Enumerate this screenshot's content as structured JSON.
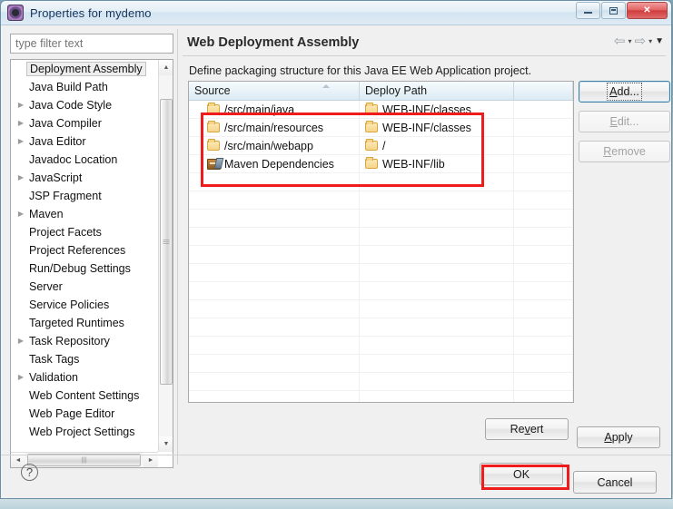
{
  "window": {
    "title": "Properties for mydemo",
    "icon": "eclipse-icon",
    "minimize_label": "",
    "maximize_label": "",
    "close_label": "✕"
  },
  "sidebar": {
    "filter": {
      "placeholder": "type filter text",
      "value": ""
    },
    "items": [
      {
        "label": "Deployment Assembly",
        "expandable": false,
        "selected": true
      },
      {
        "label": "Java Build Path",
        "expandable": false,
        "selected": false
      },
      {
        "label": "Java Code Style",
        "expandable": true,
        "selected": false
      },
      {
        "label": "Java Compiler",
        "expandable": true,
        "selected": false
      },
      {
        "label": "Java Editor",
        "expandable": true,
        "selected": false
      },
      {
        "label": "Javadoc Location",
        "expandable": false,
        "selected": false
      },
      {
        "label": "JavaScript",
        "expandable": true,
        "selected": false
      },
      {
        "label": "JSP Fragment",
        "expandable": false,
        "selected": false
      },
      {
        "label": "Maven",
        "expandable": true,
        "selected": false
      },
      {
        "label": "Project Facets",
        "expandable": false,
        "selected": false
      },
      {
        "label": "Project References",
        "expandable": false,
        "selected": false
      },
      {
        "label": "Run/Debug Settings",
        "expandable": false,
        "selected": false
      },
      {
        "label": "Server",
        "expandable": false,
        "selected": false
      },
      {
        "label": "Service Policies",
        "expandable": false,
        "selected": false
      },
      {
        "label": "Targeted Runtimes",
        "expandable": false,
        "selected": false
      },
      {
        "label": "Task Repository",
        "expandable": true,
        "selected": false
      },
      {
        "label": "Task Tags",
        "expandable": false,
        "selected": false
      },
      {
        "label": "Validation",
        "expandable": true,
        "selected": false
      },
      {
        "label": "Web Content Settings",
        "expandable": false,
        "selected": false
      },
      {
        "label": "Web Page Editor",
        "expandable": false,
        "selected": false
      },
      {
        "label": "Web Project Settings",
        "expandable": false,
        "selected": false
      }
    ]
  },
  "content": {
    "title": "Web Deployment Assembly",
    "description": "Define packaging structure for this Java EE Web Application project.",
    "nav": {
      "back_icon": "back-arrow-icon",
      "back_caret": "▾",
      "forward_icon": "forward-arrow-icon",
      "forward_caret": "▾",
      "menu_caret": "▼"
    },
    "table": {
      "columns": [
        "Source",
        "Deploy Path",
        ""
      ],
      "sorted_column": "Source",
      "rows": [
        {
          "icon": "folder-icon",
          "source": "/src/main/java",
          "deploy_path": "WEB-INF/classes"
        },
        {
          "icon": "folder-icon",
          "source": "/src/main/resources",
          "deploy_path": "WEB-INF/classes"
        },
        {
          "icon": "folder-icon",
          "source": "/src/main/webapp",
          "deploy_path": "/"
        },
        {
          "icon": "maven-icon",
          "source": "Maven Dependencies",
          "deploy_path": "WEB-INF/lib"
        }
      ],
      "empty_row_count": 16
    },
    "side_buttons": [
      {
        "label": "Add...",
        "mnemonic": "A",
        "enabled": true,
        "focused": true
      },
      {
        "label": "Edit...",
        "mnemonic": "E",
        "enabled": false,
        "focused": false
      },
      {
        "label": "Remove",
        "mnemonic": "R",
        "enabled": false,
        "focused": false
      }
    ],
    "page_buttons": [
      {
        "label": "Revert",
        "mnemonic": "v",
        "enabled": true
      },
      {
        "label": "Apply",
        "mnemonic": "A",
        "enabled": true
      }
    ]
  },
  "footer": {
    "help_icon": "help-question-icon",
    "help_glyph": "?",
    "buttons": [
      {
        "label": "OK",
        "enabled": true,
        "highlighted": true
      },
      {
        "label": "Cancel",
        "enabled": true,
        "highlighted": false
      }
    ]
  },
  "annotations": {
    "highlight_color": "#ee1c1c",
    "regions": [
      "table-rows-highlight",
      "ok-button-highlight"
    ]
  }
}
